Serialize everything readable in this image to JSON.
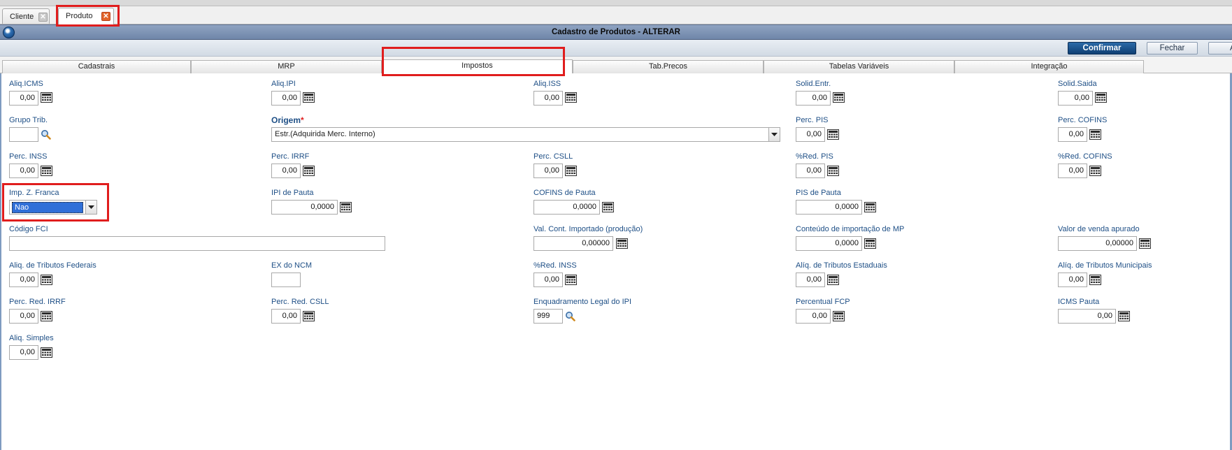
{
  "doc_tabs": {
    "cliente": "Cliente",
    "produto": "Produto",
    "close_glyph": "✕"
  },
  "window": {
    "title": "Cadastro de Produtos - ALTERAR"
  },
  "buttons": {
    "confirmar": "Confirmar",
    "fechar": "Fechar",
    "partial": "A"
  },
  "tabs": [
    "Cadastrais",
    "MRP",
    "Impostos",
    "Tab.Precos",
    "Tabelas Variáveis",
    "Integração"
  ],
  "form": {
    "aliq_icms": {
      "label": "Aliq.ICMS",
      "value": "0,00"
    },
    "aliq_ipi": {
      "label": "Aliq.IPI",
      "value": "0,00"
    },
    "aliq_iss": {
      "label": "Aliq.ISS",
      "value": "0,00"
    },
    "solid_entr": {
      "label": "Solid.Entr.",
      "value": "0,00"
    },
    "solid_saida": {
      "label": "Solid.Saida",
      "value": "0,00"
    },
    "grupo_trib": {
      "label": "Grupo Trib.",
      "value": ""
    },
    "origem": {
      "label": "Origem",
      "required": "*",
      "value": "Estr.(Adquirida Merc. Interno)"
    },
    "perc_pis": {
      "label": "Perc. PIS",
      "value": "0,00"
    },
    "perc_cofins": {
      "label": "Perc. COFINS",
      "value": "0,00"
    },
    "perc_inss": {
      "label": "Perc. INSS",
      "value": "0,00"
    },
    "perc_irrf": {
      "label": "Perc. IRRF",
      "value": "0,00"
    },
    "perc_csll": {
      "label": "Perc. CSLL",
      "value": "0,00"
    },
    "red_pis": {
      "label": "%Red. PIS",
      "value": "0,00"
    },
    "red_cofins": {
      "label": "%Red. COFINS",
      "value": "0,00"
    },
    "imp_z_franca": {
      "label": "Imp. Z. Franca",
      "value": "Nao"
    },
    "ipi_pauta": {
      "label": "IPI de Pauta",
      "value": "0,0000"
    },
    "cofins_pauta": {
      "label": "COFINS de Pauta",
      "value": "0,0000"
    },
    "pis_pauta": {
      "label": "PIS de Pauta",
      "value": "0,0000"
    },
    "codigo_fci": {
      "label": "Código FCI",
      "value": ""
    },
    "val_cont_importado": {
      "label": "Val. Cont. Importado (produção)",
      "value": "0,00000"
    },
    "conteudo_importacao": {
      "label": "Conteúdo de importação de MP",
      "value": "0,0000"
    },
    "valor_venda_apurado": {
      "label": "Valor de venda apurado",
      "value": "0,00000"
    },
    "aliq_trib_federais": {
      "label": "Aliq. de Tributos Federais",
      "value": "0,00"
    },
    "ex_ncm": {
      "label": "EX do NCM",
      "value": ""
    },
    "red_inss": {
      "label": "%Red. INSS",
      "value": "0,00"
    },
    "aliq_trib_estaduais": {
      "label": "Alíq. de Tributos Estaduais",
      "value": "0,00"
    },
    "aliq_trib_municipais": {
      "label": "Alíq. de Tributos Municipais",
      "value": "0,00"
    },
    "perc_red_irrf": {
      "label": "Perc. Red. IRRF",
      "value": "0,00"
    },
    "perc_red_csll": {
      "label": "Perc. Red. CSLL",
      "value": "0,00"
    },
    "enquadramento_ipi": {
      "label": "Enquadramento Legal do IPI",
      "value": "999"
    },
    "percentual_fcp": {
      "label": "Percentual FCP",
      "value": "0,00"
    },
    "icms_pauta": {
      "label": "ICMS Pauta",
      "value": "0,00"
    },
    "aliq_simples": {
      "label": "Aliq. Simples",
      "value": "0,00"
    }
  },
  "icons": {
    "calculator": "calculator-icon",
    "search": "search-icon",
    "dropdown": "chevron-down-icon",
    "app": "app-logo-icon",
    "close": "close-icon"
  },
  "colors": {
    "label": "#1e4f86",
    "title_bar": "#7b90b1",
    "primary_button": "#0f3f73",
    "highlight_box": "#e01d1d",
    "close_active": "#e2652b",
    "selection": "#2f6fd8"
  }
}
